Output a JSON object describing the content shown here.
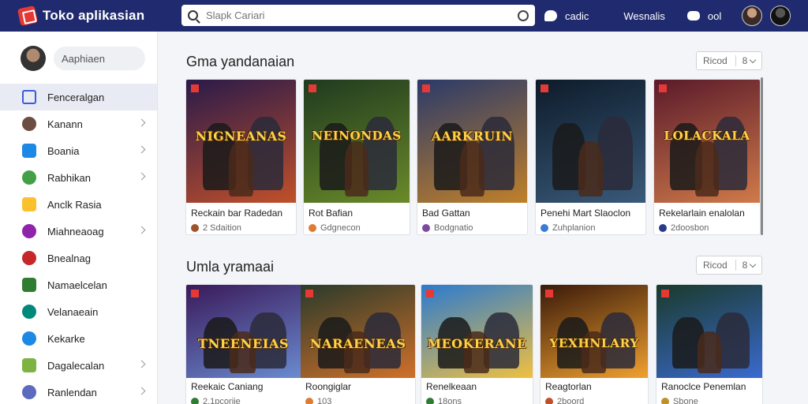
{
  "header": {
    "brand": "Toko aplikasian",
    "search_placeholder": "Slapk Cariari",
    "links": [
      "cadic",
      "Wesnalis",
      "ool"
    ]
  },
  "sidebar": {
    "profile_label": "Aaphiaen",
    "items": [
      {
        "label": "Fenceralgan",
        "icon": "home-icon",
        "color": "#3b5bdb",
        "chevron": false,
        "active": true
      },
      {
        "label": "Kanann",
        "icon": "avatar-icon",
        "color": "#6d4c41",
        "chevron": true
      },
      {
        "label": "Boania",
        "icon": "store-icon",
        "color": "#1e88e5",
        "chevron": true
      },
      {
        "label": "Rabhikan",
        "icon": "chrome-icon",
        "color": "#43a047",
        "chevron": true
      },
      {
        "label": "Anclk Rasia",
        "icon": "note-icon",
        "color": "#fbc02d",
        "chevron": false
      },
      {
        "label": "Miahneaoag",
        "icon": "puzzle-icon",
        "color": "#8e24aa",
        "chevron": true
      },
      {
        "label": "Bnealnag",
        "icon": "avatar-icon",
        "color": "#c62828",
        "chevron": false
      },
      {
        "label": "Namaelcelan",
        "icon": "app-icon",
        "color": "#2e7d32",
        "chevron": false
      },
      {
        "label": "Velanaeain",
        "icon": "globe-icon",
        "color": "#00897b",
        "chevron": false
      },
      {
        "label": "Kekarke",
        "icon": "circle-icon",
        "color": "#1e88e5",
        "chevron": false
      },
      {
        "label": "Dagalecalan",
        "icon": "landscape-icon",
        "color": "#7cb342",
        "chevron": true
      },
      {
        "label": "Ranlendan",
        "icon": "share-icon",
        "color": "#5c6bc0",
        "chevron": true
      }
    ]
  },
  "sections": [
    {
      "title": "Gma yandanaian",
      "filter_label": "Ricod",
      "filter_value": "8",
      "cards": [
        {
          "name": "Reckain bar Radedan",
          "meta": "2 Sdaition",
          "logo": "NIGNEANAS",
          "bg": [
            "#2a1a4a",
            "#c0502a"
          ],
          "dot": "#a0522d"
        },
        {
          "name": "Rot Bafian",
          "meta": "Gdgnecon",
          "logo": "NEINONDAS",
          "bg": [
            "#1f3a1f",
            "#6a8a2a"
          ],
          "dot": "#e07b30"
        },
        {
          "name": "Bad Gattan",
          "meta": "Bodgnatio",
          "logo": "AARKRUIN",
          "bg": [
            "#2a3a6a",
            "#c0802a"
          ],
          "dot": "#7a4aa0"
        },
        {
          "name": "Penehi Mart Slaoclon",
          "meta": "Zuhplanion",
          "logo": "",
          "bg": [
            "#0d1b2a",
            "#3a5a7a"
          ],
          "dot": "#3a7bd5"
        },
        {
          "name": "Rekelarlain enalolan",
          "meta": "2doosbon",
          "logo": "LOLACKALA",
          "bg": [
            "#5a1a2a",
            "#d07a4a"
          ],
          "dot": "#2a3a8a"
        }
      ]
    },
    {
      "title": "Umla yramaai",
      "filter_label": "Ricod",
      "filter_value": "8",
      "cards": [
        {
          "name": "Reekaic Caniang",
          "meta": "2.1pcoriie",
          "logo": "TNEENEIAS",
          "bg": [
            "#3a1a5a",
            "#6a8ad0"
          ],
          "dot": "#2e7d32"
        },
        {
          "name": "Roongiglar",
          "meta": "103",
          "logo": "NARAENEAS",
          "bg": [
            "#2a3a2a",
            "#d0702a"
          ],
          "dot": "#e07b30"
        },
        {
          "name": "Renelkeaan",
          "meta": "18ons",
          "logo": "MEOKERANE",
          "bg": [
            "#2a7ad0",
            "#f0c040"
          ],
          "dot": "#2e7d32"
        },
        {
          "name": "Reagtorlan",
          "meta": "2boord",
          "logo": "YEXHNLARY",
          "bg": [
            "#3a1a0a",
            "#f0a030"
          ],
          "dot": "#c0502a"
        },
        {
          "name": "Ranoclce Penemlan",
          "meta": "Sbone",
          "logo": "",
          "bg": [
            "#1a3a2a",
            "#3a6ad0"
          ],
          "dot": "#c0902a"
        }
      ]
    }
  ]
}
